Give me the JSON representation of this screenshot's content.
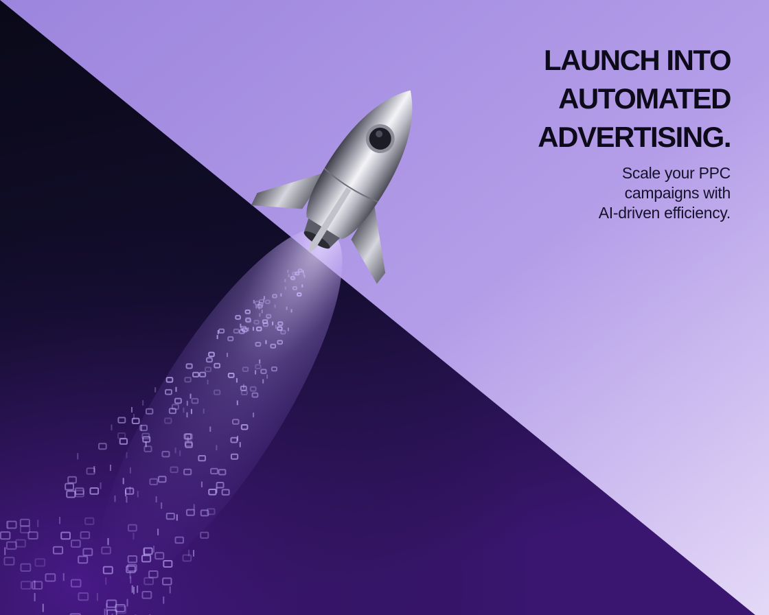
{
  "headline": {
    "lines": [
      "LAUNCH INTO",
      "AUTOMATED",
      "ADVERTISING."
    ]
  },
  "subheadline": {
    "lines": [
      "Scale your PPC",
      "campaigns with",
      "AI-driven efficiency."
    ]
  },
  "illustration": {
    "subject": "rocket-icon",
    "exhaust": "binary-data-trail"
  },
  "colors": {
    "light_purple": "#b8a3ea",
    "deep_purple": "#3a1670",
    "navy": "#0c0a1f",
    "headline": "#0d0b1a",
    "trail": "#c9b6ff"
  }
}
